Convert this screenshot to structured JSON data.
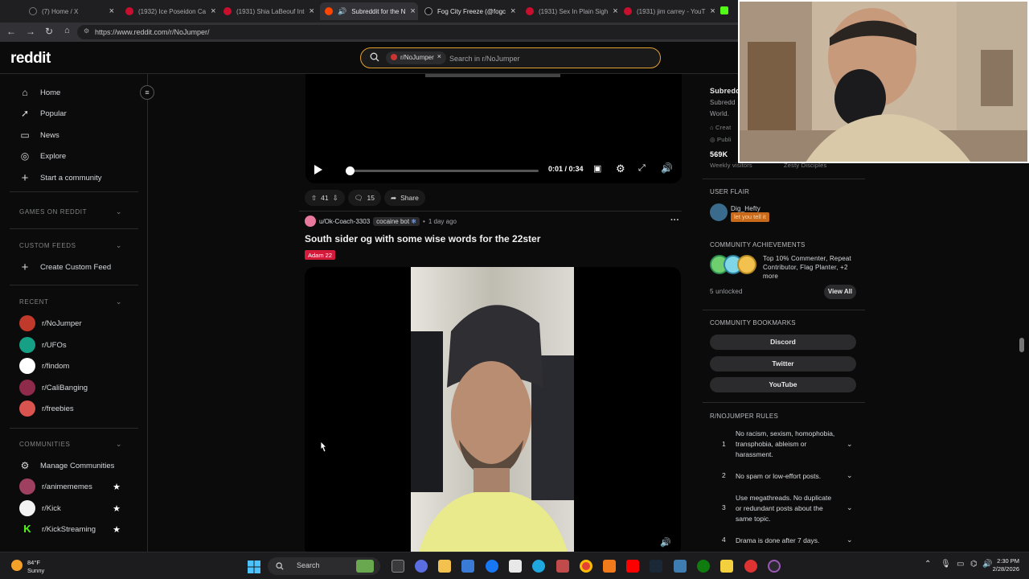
{
  "browser": {
    "tabs": [
      {
        "title": "(7) Home / X",
        "fav": "#1a1a1a"
      },
      {
        "title": "(1932) Ice Poseidon Ca",
        "fav": "#c8102e"
      },
      {
        "title": "(1931) Shia LaBeouf Int",
        "fav": "#c8102e"
      },
      {
        "title": "Subreddit for the N",
        "fav": "#ff4500"
      },
      {
        "title": "Fog City Freeze (@fogc",
        "fav": "#111"
      },
      {
        "title": "(1931) Sex In Plain Sigh",
        "fav": "#c8102e"
      },
      {
        "title": "(1931) jim carrey - YouT",
        "fav": "#c8102e"
      }
    ],
    "url": "https://www.reddit.com/r/NoJumper/"
  },
  "header": {
    "logo": "reddit",
    "search_chip": "r/NoJumper",
    "search_placeholder": "Search in r/NoJumper"
  },
  "sidebar": {
    "nav": [
      {
        "label": "Home",
        "icon": "home-icon"
      },
      {
        "label": "Popular",
        "icon": "popular-icon"
      },
      {
        "label": "News",
        "icon": "news-icon"
      },
      {
        "label": "Explore",
        "icon": "explore-icon"
      },
      {
        "label": "Start a community",
        "icon": "plus-icon"
      }
    ],
    "games_header": "GAMES ON REDDIT",
    "custom_feeds_header": "CUSTOM FEEDS",
    "create_custom_feed": "Create Custom Feed",
    "recent_header": "RECENT",
    "recent": [
      {
        "name": "r/NoJumper",
        "color": "#c0392b"
      },
      {
        "name": "r/UFOs",
        "color": "#16a085"
      },
      {
        "name": "r/findom",
        "color": "#ffffff"
      },
      {
        "name": "r/CaliBanging",
        "color": "#8e2a4a"
      },
      {
        "name": "r/freebies",
        "color": "#d9534f"
      }
    ],
    "communities_header": "COMMUNITIES",
    "manage_communities": "Manage Communities",
    "communities": [
      {
        "name": "r/animememes",
        "color": "#a04060"
      },
      {
        "name": "r/Kick",
        "color": "#f2f2f2"
      },
      {
        "name": "r/KickStreaming",
        "color": "#53fc18"
      }
    ]
  },
  "feed": {
    "video1": {
      "time": "0:01 / 0:34",
      "progress_fraction": 0.02,
      "upvotes": "41",
      "comments": "15",
      "share_label": "Share"
    },
    "post2": {
      "user": "u/Ok-Coach-3303",
      "user_flair": "cocaine bot",
      "age": "1 day ago",
      "title": "South sider og with some wise words for the 22ster",
      "tag": "Adam 22"
    }
  },
  "right_sidebar": {
    "about_title": "Subredd",
    "about_desc": "Subredd",
    "about_desc2": "World.",
    "created": "Creat",
    "public": "Publi",
    "visitors_value": "569K",
    "visitors_label": "Weekly visitors",
    "members_label": "Zesty Disciples",
    "user_flair_header": "USER FLAIR",
    "flair_user": "Dig_Hefty",
    "flair_text": "let you tell it",
    "achievements_header": "COMMUNITY ACHIEVEMENTS",
    "achievements_text": "Top 10% Commenter, Repeat Contributor, Flag Planter, +2 more",
    "unlocked": "5 unlocked",
    "view_all": "View All",
    "bookmarks_header": "COMMUNITY BOOKMARKS",
    "bookmarks": [
      "Discord",
      "Twitter",
      "YouTube"
    ],
    "rules_header": "R/NOJUMPER RULES",
    "rules": [
      {
        "num": "1",
        "text": "No racism, sexism, homophobia, transphobia, ableism or harassment."
      },
      {
        "num": "2",
        "text": "No spam or low-effort posts."
      },
      {
        "num": "3",
        "text": "Use megathreads. No duplicate or redundant posts about the same topic."
      },
      {
        "num": "4",
        "text": "Drama is done after 7 days."
      }
    ]
  },
  "taskbar": {
    "weather_temp": "84°F",
    "weather_cond": "Sunny",
    "search_label": "Search",
    "time": "2:30 PM",
    "date": "2/28/2026"
  }
}
